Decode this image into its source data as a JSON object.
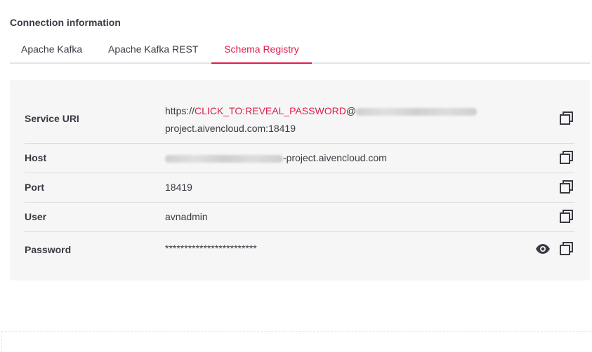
{
  "section": {
    "title": "Connection information"
  },
  "tabs": [
    {
      "label": "Apache Kafka",
      "active": false
    },
    {
      "label": "Apache Kafka REST",
      "active": false
    },
    {
      "label": "Schema Registry",
      "active": true
    }
  ],
  "fields": {
    "service_uri": {
      "label": "Service URI",
      "prefix": "https://",
      "reveal_link": "CLICK_TO:REVEAL_PASSWORD",
      "at": "@",
      "line2": "project.aivencloud.com:18419"
    },
    "host": {
      "label": "Host",
      "suffix": "-project.aivencloud.com"
    },
    "port": {
      "label": "Port",
      "value": "18419"
    },
    "user": {
      "label": "User",
      "value": "avnadmin"
    },
    "password": {
      "label": "Password",
      "value": "************************"
    }
  },
  "icons": {
    "copy": "copy-icon",
    "reveal": "eye-icon"
  },
  "colors": {
    "accent": "#e11d48",
    "panel": "#f6f6f6",
    "text": "#3a3a44"
  }
}
